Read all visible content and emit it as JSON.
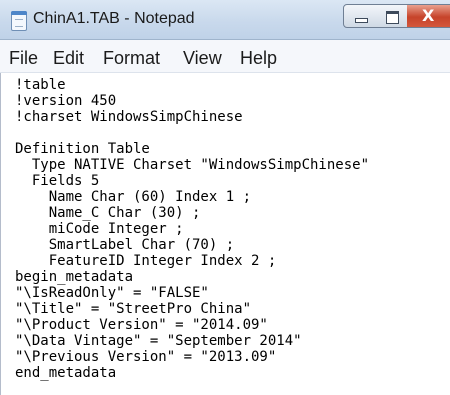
{
  "window": {
    "title": "ChinA1.TAB - Notepad",
    "app_icon": "notepad-icon",
    "controls": [
      "minimize-icon",
      "maximize-icon",
      "close-icon"
    ],
    "close_glyph": "X"
  },
  "menu": [
    "File",
    "Edit",
    "Format",
    "View",
    "Help"
  ],
  "editor": {
    "lines": [
      "!table",
      "!version 450",
      "!charset WindowsSimpChinese",
      "",
      "Definition Table",
      "  Type NATIVE Charset \"WindowsSimpChinese\"",
      "  Fields 5",
      "    Name Char (60) Index 1 ;",
      "    Name_C Char (30) ;",
      "    miCode Integer ;",
      "    SmartLabel Char (70) ;",
      "    FeatureID Integer Index 2 ;",
      "begin_metadata",
      "\"\\IsReadOnly\" = \"FALSE\"",
      "\"\\Title\" = \"StreetPro China\"",
      "\"\\Product Version\" = \"2014.09\"",
      "\"\\Data Vintage\" = \"September 2014\"",
      "\"\\Previous Version\" = \"2013.09\"",
      "end_metadata"
    ]
  },
  "colors": {
    "titlebar": "#c9d9ec",
    "close_button": "#c6432a",
    "text": "#000000"
  }
}
